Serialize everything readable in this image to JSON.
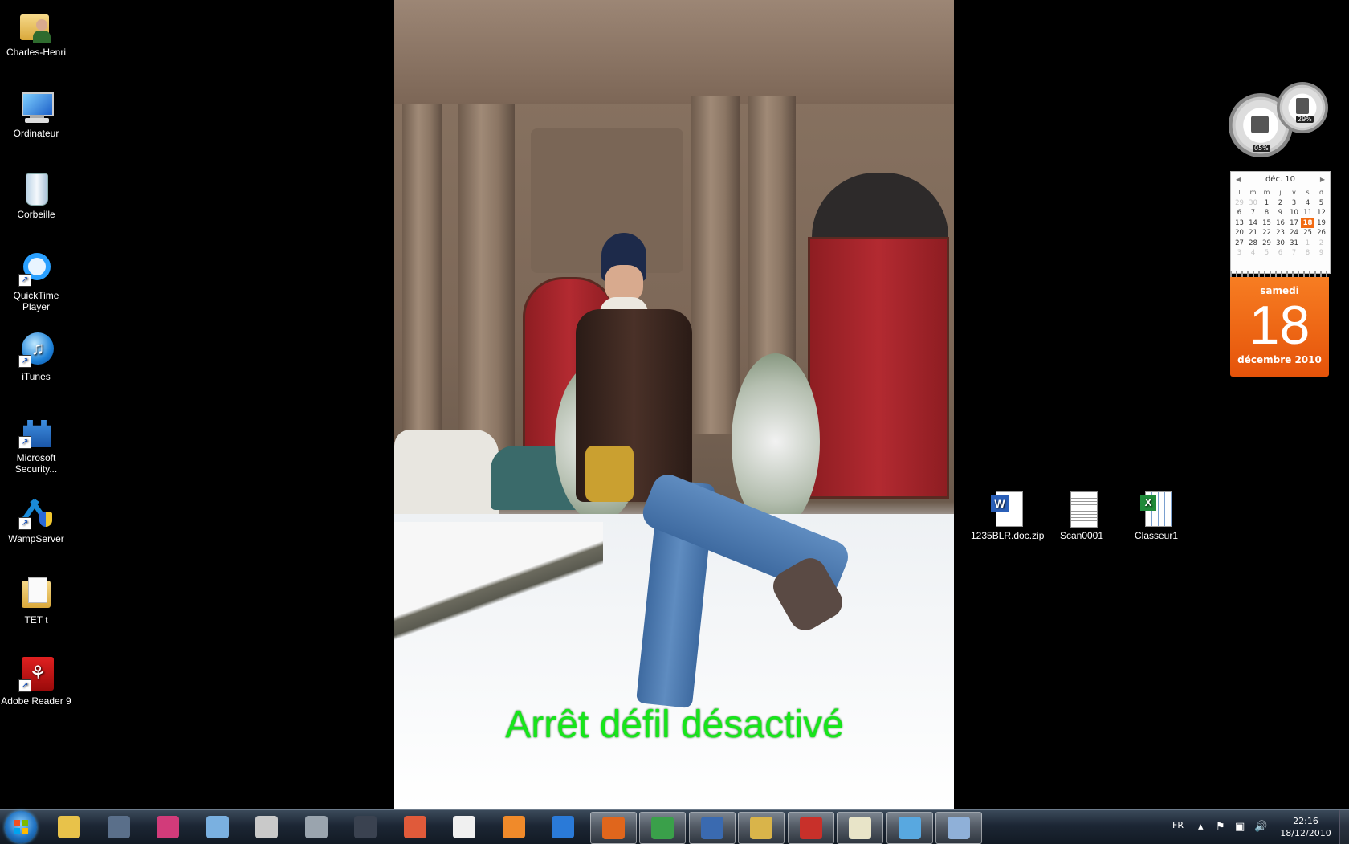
{
  "desktop": {
    "left_icons": [
      {
        "label": "Charles-Henri",
        "icon": "user-folder-icon"
      },
      {
        "label": "Ordinateur",
        "icon": "computer-icon"
      },
      {
        "label": "Corbeille",
        "icon": "recycle-bin-icon"
      },
      {
        "label": "QuickTime Player",
        "icon": "quicktime-icon"
      },
      {
        "label": "iTunes",
        "icon": "itunes-icon"
      },
      {
        "label": "Microsoft Security...",
        "icon": "security-castle-icon"
      },
      {
        "label": "WampServer",
        "icon": "wampserver-icon"
      },
      {
        "label": "TET t",
        "icon": "folder-icon"
      },
      {
        "label": "Adobe Reader 9",
        "icon": "adobe-reader-icon"
      }
    ],
    "right_icons": [
      {
        "label": "1235BLR.doc.zip",
        "icon": "word-document-icon"
      },
      {
        "label": "Scan0001",
        "icon": "scan-image-icon"
      },
      {
        "label": "Classeur1",
        "icon": "excel-spreadsheet-icon"
      }
    ],
    "osd_message": "Arrêt défil désactivé"
  },
  "gadgets": {
    "cpu_meter": {
      "cpu_percent": "05%",
      "memory_percent": "29%"
    },
    "calendar": {
      "month_short": "déc. 10",
      "weekday_headers": [
        "l",
        "m",
        "m",
        "j",
        "v",
        "s",
        "d"
      ],
      "weeks": [
        [
          "29",
          "30",
          "1",
          "2",
          "3",
          "4",
          "5"
        ],
        [
          "6",
          "7",
          "8",
          "9",
          "10",
          "11",
          "12"
        ],
        [
          "13",
          "14",
          "15",
          "16",
          "17",
          "18",
          "19"
        ],
        [
          "20",
          "21",
          "22",
          "23",
          "24",
          "25",
          "26"
        ],
        [
          "27",
          "28",
          "29",
          "30",
          "31",
          "1",
          "2"
        ],
        [
          "3",
          "4",
          "5",
          "6",
          "7",
          "8",
          "9"
        ]
      ],
      "today": "18",
      "day_name": "samedi",
      "day_number": "18",
      "month_year": "décembre 2010",
      "accent_color": "#f26a12"
    }
  },
  "taskbar": {
    "apps": [
      {
        "name": "windows-explorer",
        "color": "#e8c24a"
      },
      {
        "name": "hp",
        "color": "#5a6f8a"
      },
      {
        "name": "color-app",
        "color": "#d23b7a"
      },
      {
        "name": "transfer-app",
        "color": "#7ab0e0"
      },
      {
        "name": "utility-app",
        "color": "#c9c9c9"
      },
      {
        "name": "photo-app",
        "color": "#9aa4ae"
      },
      {
        "name": "lightroom",
        "color": "#3a4250"
      },
      {
        "name": "picasa",
        "color": "#e05a3a"
      },
      {
        "name": "blank-document",
        "color": "#f0f0f0"
      },
      {
        "name": "media-player",
        "color": "#f08a2a"
      },
      {
        "name": "internet-explorer",
        "color": "#2a7ad8"
      },
      {
        "name": "firefox",
        "color": "#e0661c"
      },
      {
        "name": "chrome",
        "color": "#3aa04a"
      },
      {
        "name": "thunderbird",
        "color": "#3a6ab0"
      },
      {
        "name": "file-manager",
        "color": "#d9b44a"
      },
      {
        "name": "acrobat-tool",
        "color": "#c8302a"
      },
      {
        "name": "notepad",
        "color": "#e8e4c8"
      },
      {
        "name": "people-app",
        "color": "#58a8e0"
      },
      {
        "name": "paint",
        "color": "#8fb0d8"
      }
    ],
    "language": "FR",
    "clock_time": "22:16",
    "clock_date": "18/12/2010"
  }
}
